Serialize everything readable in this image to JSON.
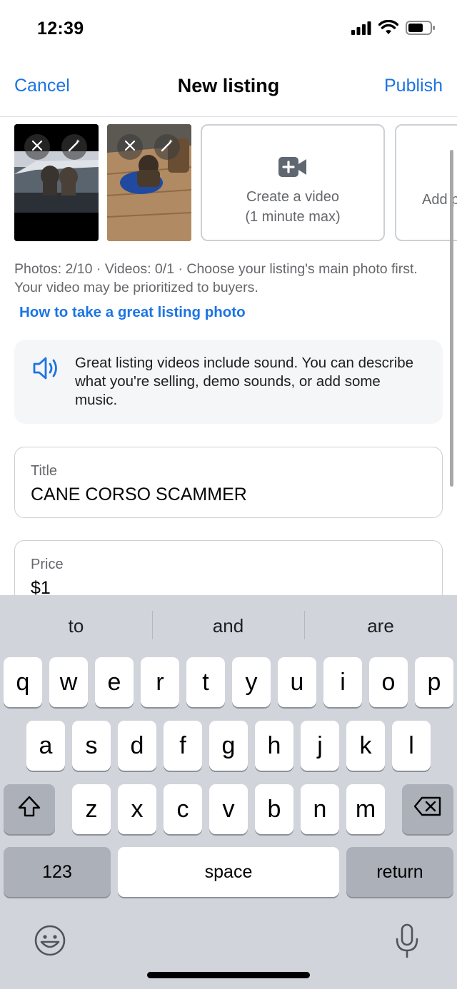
{
  "status_bar": {
    "time": "12:39",
    "icons": [
      "signal-icon",
      "wifi-icon",
      "battery-icon"
    ]
  },
  "nav": {
    "cancel_label": "Cancel",
    "title": "New listing",
    "publish_label": "Publish"
  },
  "media": {
    "thumbnails": [
      {
        "description_icon": "photo-thumbnail",
        "remove_icon": "close-icon",
        "edit_icon": "magic-wand-icon"
      },
      {
        "description_icon": "photo-thumbnail",
        "remove_icon": "close-icon",
        "edit_icon": "magic-wand-icon"
      }
    ],
    "create_video": {
      "line1": "Create a video",
      "line2": "(1 minute max)",
      "icon": "video-plus-icon"
    },
    "add_photos_partial": "Add p"
  },
  "meta_text": "Photos: 2/10 · Videos: 0/1 · Choose your listing's main photo first. Your video may be prioritized to buyers.",
  "howto_link": "How to take a great listing photo",
  "tip": {
    "icon": "speaker-icon",
    "text": "Great listing videos include sound. You can describe what you're selling, demo sounds, or add some music."
  },
  "fields": {
    "title": {
      "label": "Title",
      "value": "CANE CORSO SCAMMER"
    },
    "price": {
      "label": "Price",
      "value": "$1"
    }
  },
  "keyboard": {
    "suggestions": [
      "to",
      "and",
      "are"
    ],
    "row1": [
      "q",
      "w",
      "e",
      "r",
      "t",
      "y",
      "u",
      "i",
      "o",
      "p"
    ],
    "row2": [
      "a",
      "s",
      "d",
      "f",
      "g",
      "h",
      "j",
      "k",
      "l"
    ],
    "row3": [
      "z",
      "x",
      "c",
      "v",
      "b",
      "n",
      "m"
    ],
    "numbers_label": "123",
    "space_label": "space",
    "return_label": "return",
    "accent_color": "#1b74e4"
  }
}
